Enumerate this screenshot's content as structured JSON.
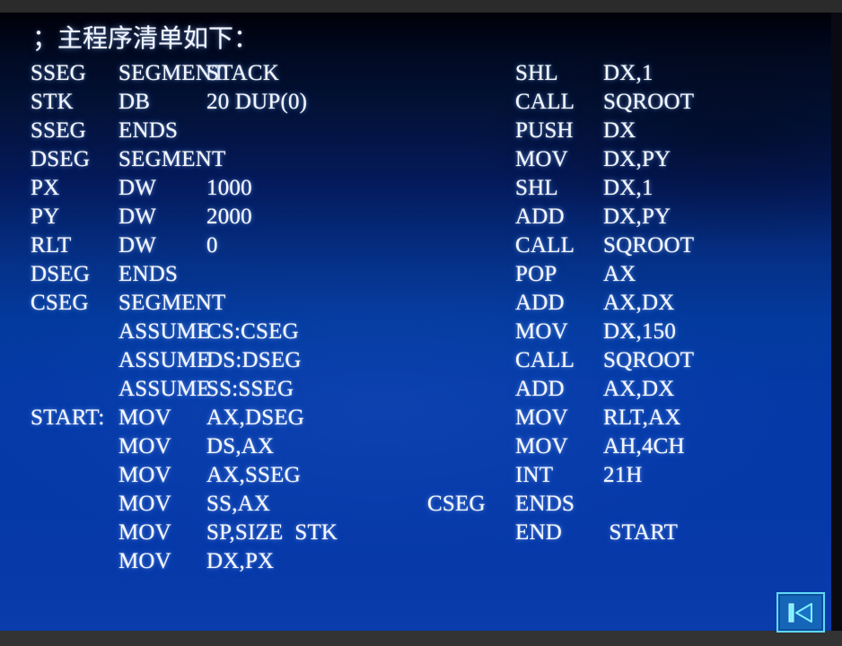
{
  "slide": {
    "title_comment": "；主程序清单如下：",
    "background_top_color": "#000008",
    "background_bottom_color": "#0a3cab",
    "text_color": "#f2f6ff",
    "letterbox_color": "#333333"
  },
  "nav": {
    "prev_button_label": "Previous slide",
    "prev_button_icon": "skip-to-start-icon",
    "accent_color": "#5fd8f5",
    "button_fill_color": "#1565b8"
  },
  "code": {
    "left_column": [
      {
        "label": "SSEG",
        "op": "SEGMENT",
        "operand": "STACK"
      },
      {
        "label": "STK",
        "op": "DB",
        "operand": "20 DUP(0)"
      },
      {
        "label": "SSEG",
        "op": "ENDS",
        "operand": ""
      },
      {
        "label": "DSEG",
        "op": "SEGMENT",
        "operand": ""
      },
      {
        "label": "PX",
        "op": "DW",
        "operand": "1000"
      },
      {
        "label": "PY",
        "op": "DW",
        "operand": "2000"
      },
      {
        "label": "RLT",
        "op": "DW",
        "operand": "0"
      },
      {
        "label": "DSEG",
        "op": "ENDS",
        "operand": ""
      },
      {
        "label": "CSEG",
        "op": "SEGMENT",
        "operand": ""
      },
      {
        "label": "",
        "op": "ASSUME",
        "operand": "CS:CSEG"
      },
      {
        "label": "",
        "op": "ASSUME",
        "operand": "DS:DSEG"
      },
      {
        "label": "",
        "op": "ASSUME",
        "operand": "SS:SSEG"
      },
      {
        "label": "START:",
        "op": "MOV",
        "operand": "AX,DSEG"
      },
      {
        "label": "",
        "op": "MOV",
        "operand": "DS,AX"
      },
      {
        "label": "",
        "op": "MOV",
        "operand": "AX,SSEG"
      },
      {
        "label": "",
        "op": "MOV",
        "operand": "SS,AX"
      },
      {
        "label": "",
        "op": "MOV",
        "operand": "SP,SIZE  STK"
      },
      {
        "label": "",
        "op": "MOV",
        "operand": "DX,PX"
      }
    ],
    "right_column": [
      {
        "label": "",
        "op": "SHL",
        "operand": "DX,1"
      },
      {
        "label": "",
        "op": "CALL",
        "operand": "SQROOT"
      },
      {
        "label": "",
        "op": "PUSH",
        "operand": "DX"
      },
      {
        "label": "",
        "op": "MOV",
        "operand": "DX,PY"
      },
      {
        "label": "",
        "op": "SHL",
        "operand": "DX,1"
      },
      {
        "label": "",
        "op": "ADD",
        "operand": "DX,PY"
      },
      {
        "label": "",
        "op": "CALL",
        "operand": "SQROOT"
      },
      {
        "label": "",
        "op": "POP",
        "operand": "AX"
      },
      {
        "label": "",
        "op": "ADD",
        "operand": "AX,DX"
      },
      {
        "label": "",
        "op": "MOV",
        "operand": "DX,150"
      },
      {
        "label": "",
        "op": "CALL",
        "operand": "SQROOT"
      },
      {
        "label": "",
        "op": "ADD",
        "operand": "AX,DX"
      },
      {
        "label": "",
        "op": "MOV",
        "operand": "RLT,AX"
      },
      {
        "label": "",
        "op": "MOV",
        "operand": "AH,4CH"
      },
      {
        "label": "",
        "op": "INT",
        "operand": "21H"
      },
      {
        "label": "CSEG",
        "op": "ENDS",
        "operand": ""
      },
      {
        "label": "",
        "op": "END",
        "operand": " START"
      }
    ]
  }
}
